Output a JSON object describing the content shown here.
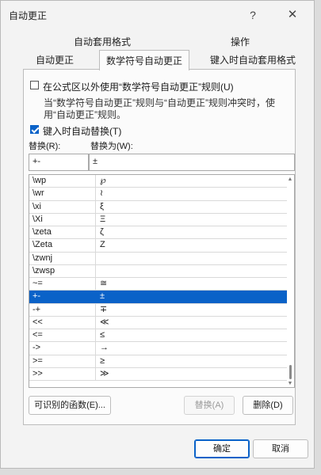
{
  "window": {
    "title": "自动更正",
    "help_glyph": "?",
    "close_glyph": "✕"
  },
  "tabs": {
    "top": [
      "自动套用格式",
      "操作"
    ],
    "bottom": [
      "自动更正",
      "数学符号自动更正",
      "键入时自动套用格式"
    ],
    "active": "数学符号自动更正"
  },
  "panel": {
    "outside_formula": {
      "label": "在公式区以外使用“数学符号自动更正”规则(U)",
      "checked": false
    },
    "note": "当“数学符号自动更正”规则与“自动更正”规则冲突时，使用“自动更正”规则。",
    "replace_as_type": {
      "label": "键入时自动替换(T)",
      "checked": true
    },
    "replace_label": "替换(R):",
    "with_label": "替换为(W):",
    "replace_value": "+-",
    "with_value": "±"
  },
  "entries": [
    {
      "name": "\\wp",
      "symbol": "℘"
    },
    {
      "name": "\\wr",
      "symbol": "≀"
    },
    {
      "name": "\\xi",
      "symbol": "ξ"
    },
    {
      "name": "\\Xi",
      "symbol": "Ξ"
    },
    {
      "name": "\\zeta",
      "symbol": "ζ"
    },
    {
      "name": "\\Zeta",
      "symbol": "Ζ"
    },
    {
      "name": "\\zwnj",
      "symbol": ""
    },
    {
      "name": "\\zwsp",
      "symbol": ""
    },
    {
      "name": "~=",
      "symbol": "≅"
    },
    {
      "name": "+-",
      "symbol": "±",
      "selected": true
    },
    {
      "name": "-+",
      "symbol": "∓"
    },
    {
      "name": "<<",
      "symbol": "≪"
    },
    {
      "name": "<=",
      "symbol": "≤"
    },
    {
      "name": "->",
      "symbol": "→"
    },
    {
      "name": ">=",
      "symbol": "≥"
    },
    {
      "name": ">>",
      "symbol": "≫"
    }
  ],
  "buttons": {
    "functions": "可识别的函数(E)...",
    "replace": "替换(A)",
    "delete": "删除(D)",
    "ok": "确定",
    "cancel": "取消"
  },
  "colors": {
    "accent": "#0a62c8"
  }
}
